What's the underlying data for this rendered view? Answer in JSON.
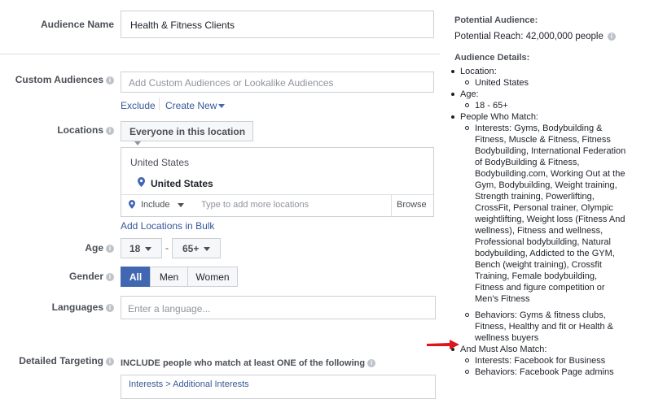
{
  "form": {
    "audience_name": {
      "label": "Audience Name",
      "value": "Health & Fitness Clients"
    },
    "custom_audiences": {
      "label": "Custom Audiences",
      "placeholder": "Add Custom Audiences or Lookalike Audiences",
      "exclude": "Exclude",
      "create_new": "Create New"
    },
    "locations": {
      "label": "Locations",
      "dropdown": "Everyone in this location",
      "country_header": "United States",
      "selected": "United States",
      "include": "Include",
      "placeholder": "Type to add more locations",
      "browse": "Browse",
      "bulk": "Add Locations in Bulk"
    },
    "age": {
      "label": "Age",
      "min": "18",
      "separator": "-",
      "max": "65+"
    },
    "gender": {
      "label": "Gender",
      "options": [
        "All",
        "Men",
        "Women"
      ],
      "selected": "All"
    },
    "languages": {
      "label": "Languages",
      "placeholder": "Enter a language..."
    },
    "detailed_targeting": {
      "label": "Detailed Targeting",
      "include_text": "INCLUDE people who match at least ONE of the following",
      "breadcrumb": "Interests > Additional Interests"
    }
  },
  "summary": {
    "potential_title": "Potential Audience:",
    "potential_reach": "Potential Reach: 42,000,000 people",
    "details_title": "Audience Details:",
    "location_label": "Location:",
    "location_value": "United States",
    "age_label": "Age:",
    "age_value": "18 - 65+",
    "people_label": "People Who Match:",
    "interests_lines": [
      "Interests: Gyms, Bodybuilding &",
      "Fitness, Muscle & Fitness, Fitness",
      "Bodybuilding, International Federation",
      "of BodyBuilding & Fitness,",
      "Bodybuilding.com, Working Out at the",
      "Gym, Bodybuilding, Weight training,",
      "Strength training, Powerlifting,",
      "CrossFit, Personal trainer, Olympic",
      "weightlifting, Weight loss (Fitness And",
      "wellness), Fitness and wellness,",
      "Professional bodybuilding, Natural",
      "bodybuilding, Addicted to the GYM,",
      "Bench (weight training), Crossfit",
      "Training, Female bodybuilding,",
      "Fitness and figure competition or",
      "Men's Fitness"
    ],
    "behaviors_lines": [
      "Behaviors: Gyms & fitness clubs,",
      "Fitness, Healthy and fit or Health &",
      "wellness buyers"
    ],
    "must_label": "And Must Also Match:",
    "must_items": [
      "Interests: Facebook for Business",
      "Behaviors: Facebook Page admins"
    ]
  },
  "colors": {
    "accent": "#4267b2",
    "link": "#365899",
    "arrow": "#e0141e"
  }
}
